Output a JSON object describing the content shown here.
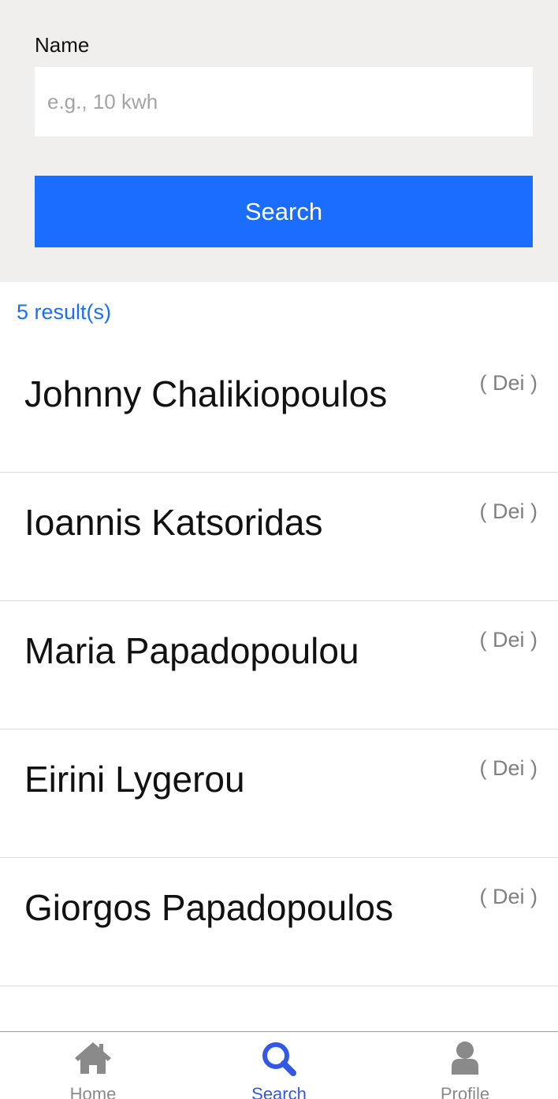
{
  "form": {
    "name_label": "Name",
    "name_placeholder": "e.g., 10 kwh",
    "name_value": "",
    "search_label": "Search"
  },
  "results": {
    "count_text": "5 result(s)",
    "items": [
      {
        "name": "Johnny Chalikiopoulos",
        "tag": "( Dei )"
      },
      {
        "name": "Ioannis Katsoridas",
        "tag": "( Dei )"
      },
      {
        "name": "Maria Papadopoulou",
        "tag": "( Dei )"
      },
      {
        "name": "Eirini Lygerou",
        "tag": "( Dei )"
      },
      {
        "name": "Giorgos Papadopoulos",
        "tag": "( Dei )"
      }
    ]
  },
  "tabbar": {
    "tabs": [
      {
        "label": "Home",
        "icon": "home-icon",
        "active": false
      },
      {
        "label": "Search",
        "icon": "search-icon",
        "active": true
      },
      {
        "label": "Profile",
        "icon": "profile-icon",
        "active": false
      }
    ]
  },
  "colors": {
    "accent": "#1a6dff",
    "active_tab": "#3358e8",
    "inactive_tab": "#8a8a8a",
    "panel_bg": "#f0efed"
  }
}
